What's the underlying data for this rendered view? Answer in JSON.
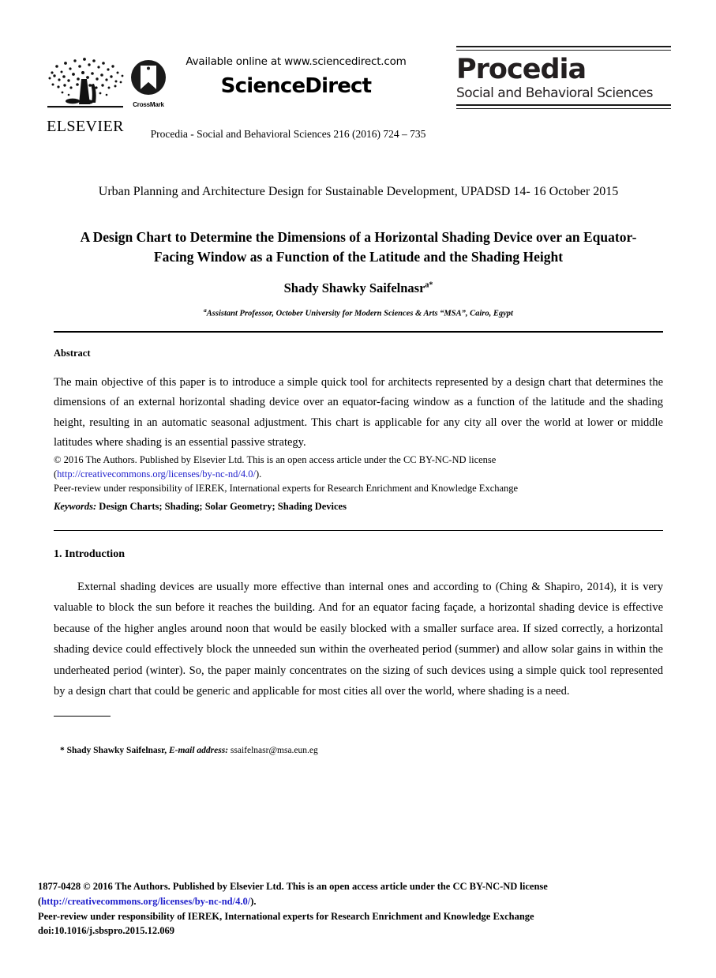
{
  "masthead": {
    "elsevier_wordmark": "ELSEVIER",
    "elsevier_logo_icon": "elsevier-tree-icon",
    "crossmark_label": "CrossMark",
    "crossmark_logo_icon": "crossmark-icon",
    "available_online": "Available online at www.sciencedirect.com",
    "sciencedirect_wordmark": "ScienceDirect",
    "procedia_title": "Procedia",
    "procedia_subtitle": "Social and Behavioral Sciences",
    "journal_reference": "Procedia - Social and Behavioral Sciences 216 (2016) 724 – 735"
  },
  "article": {
    "conference_line": "Urban Planning and Architecture Design for Sustainable Development, UPADSD 14- 16 October 2015",
    "title": "A Design Chart to Determine the Dimensions of a Horizontal Shading Device over an Equator-Facing Window as a Function of the Latitude and the Shading Height",
    "author_name": "Shady Shawky Saifelnasr",
    "author_marker": "a*",
    "affiliation_marker": "a",
    "affiliation": "Assistant Professor, October University for Modern Sciences & Arts “MSA”, Cairo, Egypt"
  },
  "abstract": {
    "heading": "Abstract",
    "text": "The main objective of this paper is to introduce a simple quick tool for architects represented by a design chart that determines the dimensions of an external horizontal shading device over an equator-facing window as a function of the latitude and the shading height, resulting in an automatic seasonal adjustment. This chart is applicable for any city all over the world at lower or middle latitudes where shading is an essential passive strategy."
  },
  "license": {
    "line1": "© 2016 The Authors. Published by Elsevier Ltd. This is an open access article under the CC BY-NC-ND license",
    "url_open": "(",
    "url": "http://creativecommons.org/licenses/by-nc-nd/4.0/",
    "url_close": ").",
    "line3": "Peer-review under responsibility of IEREK, International experts for Research Enrichment and Knowledge Exchange"
  },
  "keywords": {
    "label": "Keywords:",
    "values": "Design Charts; Shading; Solar Geometry; Shading Devices"
  },
  "introduction": {
    "heading": "1. Introduction",
    "paragraph": "External shading devices are usually more effective than internal ones and according to (Ching & Shapiro, 2014), it is very valuable to block the sun before it reaches the building. And for an equator facing façade, a horizontal shading device is effective because of the higher angles around noon that would be easily blocked with a smaller surface area. If sized correctly, a horizontal shading device could effectively block the unneeded sun within the overheated period (summer) and allow solar gains in within the underheated period (winter). So, the paper mainly concentrates on the sizing of such devices using a simple quick tool represented by a design chart that could be generic and applicable for most cities all over the world, where shading is a need."
  },
  "footnote": {
    "marker": "*",
    "name": "Shady Shawky Saifelnasr,",
    "email_label": "E-mail address:",
    "email": "ssaifelnasr@msa.eun.eg"
  },
  "footer": {
    "line1": "1877-0428 © 2016 The Authors. Published by Elsevier Ltd. This is an open access article under the CC BY-NC-ND license",
    "url_open": "(",
    "url": "http://creativecommons.org/licenses/by-nc-nd/4.0/",
    "url_close": ").",
    "line3": "Peer-review under responsibility of IEREK, International experts for Research Enrichment and Knowledge Exchange",
    "doi": "doi:10.1016/j.sbspro.2015.12.069"
  },
  "colors": {
    "text": "#000000",
    "link": "#2222cc",
    "logo": "#231f20"
  }
}
